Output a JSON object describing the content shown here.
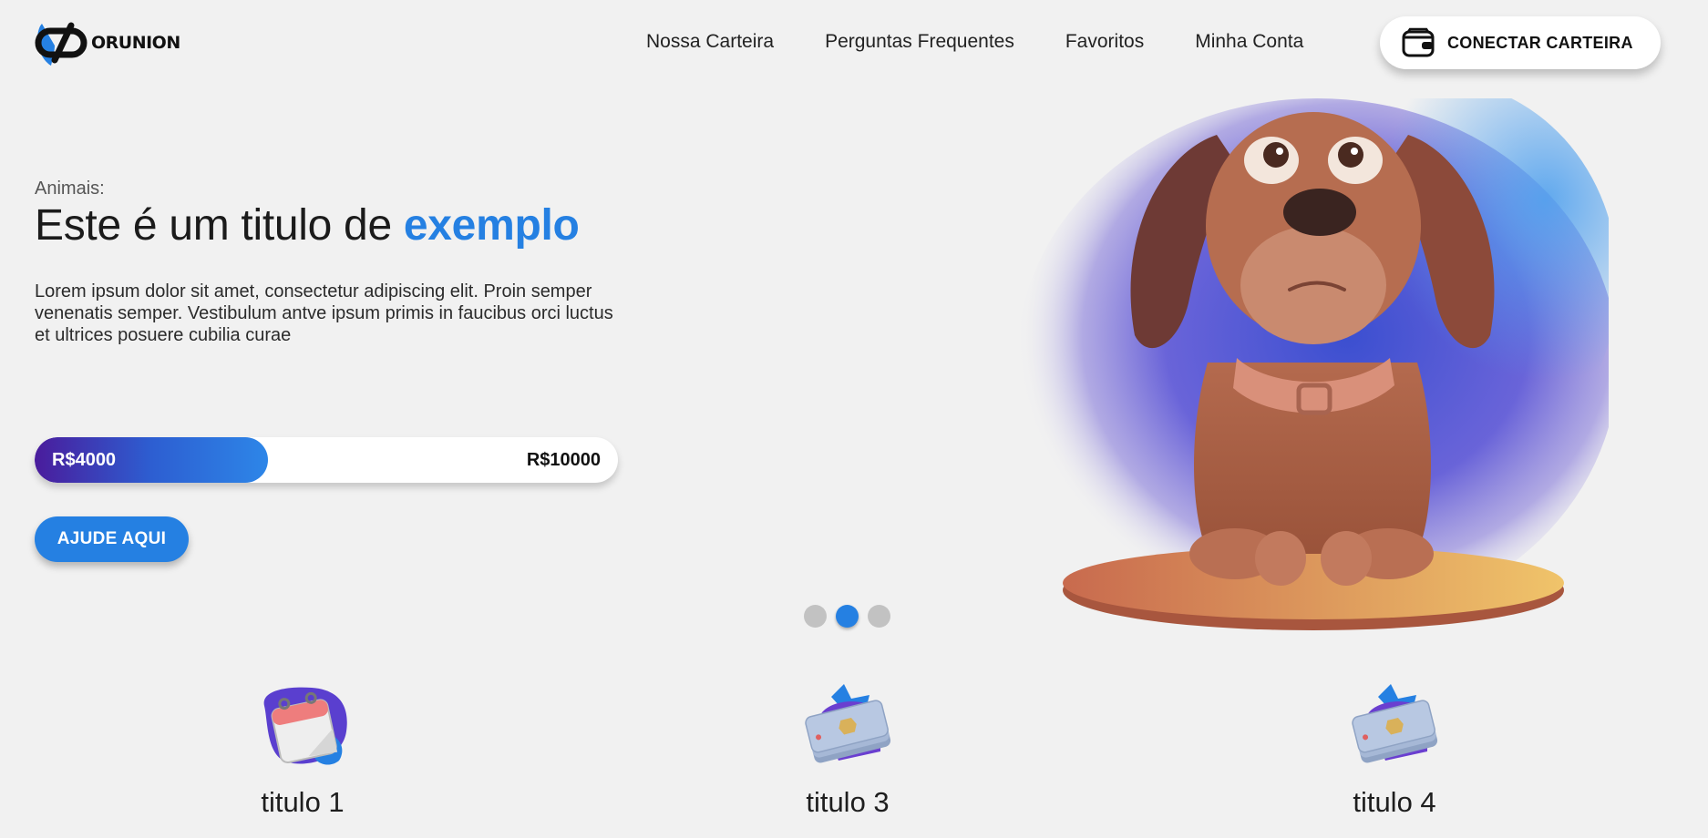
{
  "brand": {
    "name": "ORUNION",
    "accent": "#2580e2"
  },
  "nav": {
    "items": [
      "Nossa Carteira",
      "Perguntas Frequentes",
      "Favoritos",
      "Minha Conta"
    ],
    "connect_label": "CONECTAR CARTEIRA",
    "connect_icon": "wallet-icon"
  },
  "hero": {
    "eyebrow": "Animais:",
    "title_main": "Este é um titulo de ",
    "title_accent": "exemplo",
    "description": "Lorem ipsum dolor sit amet, consectetur adipiscing elit. Proin semper venenatis semper. Vestibulum antve ipsum primis in faucibus orci luctus et ultrices posuere cubilia curae",
    "progress": {
      "current_label": "R$4000",
      "goal_label": "R$10000",
      "current": 4000,
      "goal": 10000
    },
    "cta_label": "AJUDE AQUI",
    "image": "cartoon-dog-illustration"
  },
  "carousel": {
    "count": 3,
    "active_index": 1
  },
  "features": [
    {
      "title": "titulo 1",
      "icon": "calendar-icon"
    },
    {
      "title": "titulo 3",
      "icon": "credit-cards-icon"
    },
    {
      "title": "titulo 4",
      "icon": "credit-cards-icon"
    }
  ]
}
